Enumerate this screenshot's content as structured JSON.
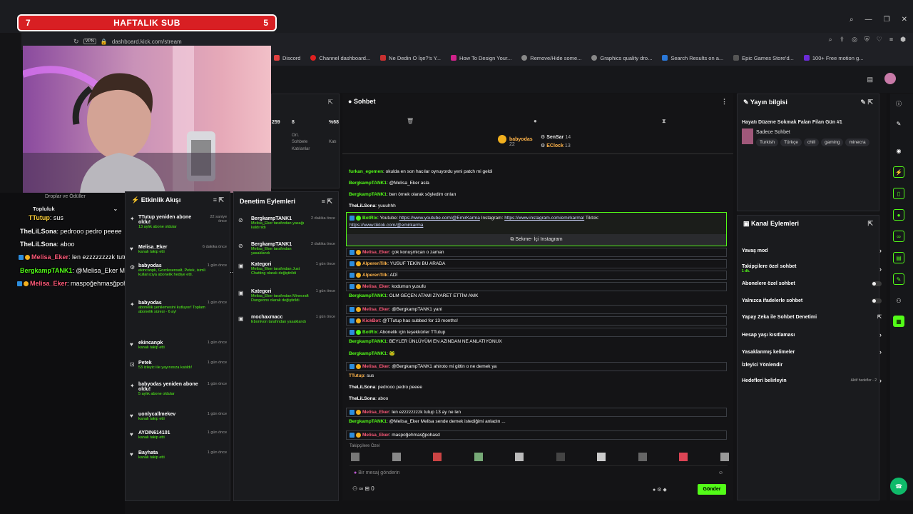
{
  "browser": {
    "url": "dashboard.kick.com/stream",
    "vpn": "VPN",
    "bookmarks": [
      "Discord",
      "Channel dashboard...",
      "Ne Dedin O İşe?'s Y...",
      "How To Design Your...",
      "Remove/Hide some...",
      "Graphics quality dro...",
      "Search Results on a...",
      "Epic Games Store'd...",
      "100+ Free motion g..."
    ]
  },
  "banner": {
    "left": "7",
    "title": "HAFTALIK SUB",
    "right": "5"
  },
  "overlay": {
    "header": "Topluluk",
    "lines": [
      {
        "name": "TTutup",
        "text": ": sus"
      },
      {
        "name": "TheLiLSona",
        "text": ": pedrooo pedro peeee"
      },
      {
        "name": "TheLiLSona",
        "text": ": aboo"
      },
      {
        "name": "Melisa_Eker",
        "text": ": len ezzzzzzzzk tutup 13 ay ne len"
      },
      {
        "name": "BergkampTANK1",
        "text": ": @Melisa_Eker Melisa sende demek istediğimi anladın..."
      },
      {
        "name": "Melisa_Eker",
        "text": ": maspoğehmasğpohasd"
      }
    ],
    "faded": "Droplar ve Ödüller"
  },
  "stats": {
    "v1": "259",
    "v2": "8",
    "v3": "%68",
    "label1": "Ort.",
    "label2": "Sohbete",
    "label3": "Katılanlar",
    "label4": "Katı"
  },
  "activity": {
    "title": "Etkinlik Akışı",
    "items": [
      {
        "name": "TTutup yeniden abone oldu!",
        "sub": "13 aylık abone oldular",
        "time": "22 saniye önce"
      },
      {
        "name": "Melisa_Eker",
        "sub": "kanalı takip etti",
        "time": "6 dakika önce"
      },
      {
        "name": "babyodas",
        "sub": "ekincanpk, Gozdesensalt, Petek, isimli kullanıcıya abonelik hediye etti.",
        "time": "1 gün önce"
      },
      {
        "name": "babyodas",
        "sub": "abonelik yenilemesini kutluyor! Toplam abonelik süresi - 6 ay!",
        "time": "1 gün önce"
      },
      {
        "name": "ekincanpk",
        "sub": "kanalı takip etti",
        "time": "1 gün önce"
      },
      {
        "name": "Petek",
        "sub": "53 izleyici ile yayınınıza katıldı!",
        "time": "1 gün önce"
      },
      {
        "name": "babyodas yeniden abone oldu!",
        "sub": "5 aylık abone oldular",
        "time": "1 gün önce"
      },
      {
        "name": "uonlycallmekev",
        "sub": "kanalı takip etti",
        "time": "1 gün önce"
      },
      {
        "name": "AYDIN614101",
        "sub": "kanalı takip etti",
        "time": "1 gün önce"
      },
      {
        "name": "Bayhata",
        "sub": "kanalı takip etti",
        "time": "1 gün önce"
      }
    ]
  },
  "moderation": {
    "title": "Denetim Eylemleri",
    "items": [
      {
        "name": "BergkampTANK1",
        "sub": "Melisa_Eker tarafından yasağı kaldırıldı",
        "time": "2 dakika önce"
      },
      {
        "name": "BergkampTANK1",
        "sub": "Melisa_Eker tarafından yasaklandı",
        "time": "2 dakika önce"
      },
      {
        "name": "Kategori",
        "sub": "Melisa_Eker tarafından Just Chatting olarak değiştirildi",
        "time": "1 gün önce"
      },
      {
        "name": "Kategori",
        "sub": "Melisa_Eker tarafından Minecraft Dungeons olarak değiştirildi",
        "time": "1 gün önce"
      },
      {
        "name": "mochaxmacc",
        "sub": "Ebonivon tarafından yasaklandı",
        "time": "1 gün önce"
      }
    ]
  },
  "chat": {
    "title": "Sohbet",
    "leaders": [
      {
        "name": "babyodas",
        "count": "22"
      },
      {
        "name": "SenSar",
        "count": "14"
      },
      {
        "name": "EClock",
        "count": "13"
      }
    ],
    "messages": [
      {
        "name": "furkan_egemen",
        "cls": "n-g",
        "text": ": okulda en son hacılar oynuyordu yeni patch mi geldi",
        "box": false
      },
      {
        "name": "BergkampTANK1",
        "cls": "n-g",
        "text": ": @Melisa_Eker asla",
        "box": false
      },
      {
        "name": "BergkampTANK1",
        "cls": "n-g",
        "text": ": ben örnek olarak söyledim onları",
        "box": false
      },
      {
        "name": "TheLiLSona",
        "cls": "n-w",
        "text": ": yuuuhhh",
        "box": false
      },
      {
        "name": "Melisa_Eker",
        "cls": "n-r",
        "text": ": çok konuşmican o zaman",
        "box": true
      },
      {
        "name": "AlperenTilk",
        "cls": "n-y",
        "text": ": YUSUF TEKİN BU ARADA",
        "box": true
      },
      {
        "name": "AlperenTilk",
        "cls": "n-y",
        "text": ": ADİ",
        "box": true
      },
      {
        "name": "Melisa_Eker",
        "cls": "n-r",
        "text": ": kodumun yusufu",
        "box": true
      },
      {
        "name": "BergkampTANK1",
        "cls": "n-g",
        "text": ": OLM GEÇEN ATAMI ZİYARET ETTİM AMK",
        "box": false
      },
      {
        "name": "Melisa_Eker",
        "cls": "n-r",
        "text": ": @BergkampTANK1 yani",
        "box": true
      },
      {
        "name": "KickBot",
        "cls": "n-r",
        "text": ": @TTutup has subbed for 13 months!",
        "box": true
      },
      {
        "name": "BotRix",
        "cls": "n-g",
        "text": ": Abonelik için teşekkürler TTutup",
        "box": true
      },
      {
        "name": "BergkampTANK1",
        "cls": "n-g",
        "text": ": BEYLER ÜNLÜYÜM EN AZINDAN NE ANLATIYONUX",
        "box": false
      },
      {
        "name": "BergkampTANK1",
        "cls": "n-g",
        "text": ": 🐸",
        "box": false
      },
      {
        "name": "Melisa_Eker",
        "cls": "n-r",
        "text": ": @BergkampTANK1 ahiroto mi gittin o ne demek ya",
        "box": true
      },
      {
        "name": "TTutup",
        "cls": "n-y",
        "text": ": sus",
        "box": false
      },
      {
        "name": "TheLiLSona",
        "cls": "n-w",
        "text": ": pedrooo pedro peeee",
        "box": false
      },
      {
        "name": "TheLiLSona",
        "cls": "n-w",
        "text": ": aboo",
        "box": false
      },
      {
        "name": "Melisa_Eker",
        "cls": "n-r",
        "text": ": len ezzzzzzzzk tutup 13 ay ne len",
        "box": true
      },
      {
        "name": "BergkampTANK1",
        "cls": "n-g",
        "text": ": @Melisa_Eker Melisa sende demek istediğimi anladın ...",
        "box": false
      },
      {
        "name": "Melisa_Eker",
        "cls": "n-r",
        "text": ": maspoğehmasğpohasd",
        "box": true
      }
    ],
    "botrix": {
      "name": "BotRix",
      "pre": ": Youtube: ",
      "yt": "https://www.youtube.com/@EmirKarma",
      "ig_label": " Instagram: ",
      "ig": "https://www.instagram.com/emirkarma/",
      "tt_label": " Tiktok:",
      "tt": "https://www.tiktok.com/@emirkarma",
      "button": "Sekme- İçi Instagram"
    },
    "followers_only": "Takipçilere Özel",
    "placeholder": "Bir mesaj gönderin",
    "points": "0",
    "send": "Gönder"
  },
  "info": {
    "title": "Yayın bilgisi",
    "stream_title": "Hayatı Düzene Sokmak Falan Filan Gün #1",
    "category": "Sadece Sohbet",
    "tags": [
      "Turkish",
      "Türkçe",
      "chill",
      "gaming",
      "minecra"
    ]
  },
  "actions": {
    "title": "Kanal Eylemleri",
    "rows": [
      {
        "label": "Yavaş mod",
        "ctl": "chev"
      },
      {
        "label": "Takipçilere özel sohbet",
        "sub": "1 dk.",
        "ctl": "chev"
      },
      {
        "label": "Abonelere özel sohbet",
        "ctl": "toggle"
      },
      {
        "label": "Yalnızca ifadelerle sohbet",
        "ctl": "toggle"
      },
      {
        "label": "Yapay Zeka ile Sohbet Denetimi",
        "ctl": "ext"
      },
      {
        "label": "Hesap yaşı kısıtlaması",
        "ctl": "chev"
      },
      {
        "label": "Yasaklanmış kelimeler",
        "ctl": "chev"
      },
      {
        "label": "İzleyici Yönlendir",
        "ctl": "none"
      },
      {
        "label": "Hedefleri belirleyin",
        "ctl": "chev",
        "sub2": "Aktif hedefler - 2"
      }
    ]
  }
}
